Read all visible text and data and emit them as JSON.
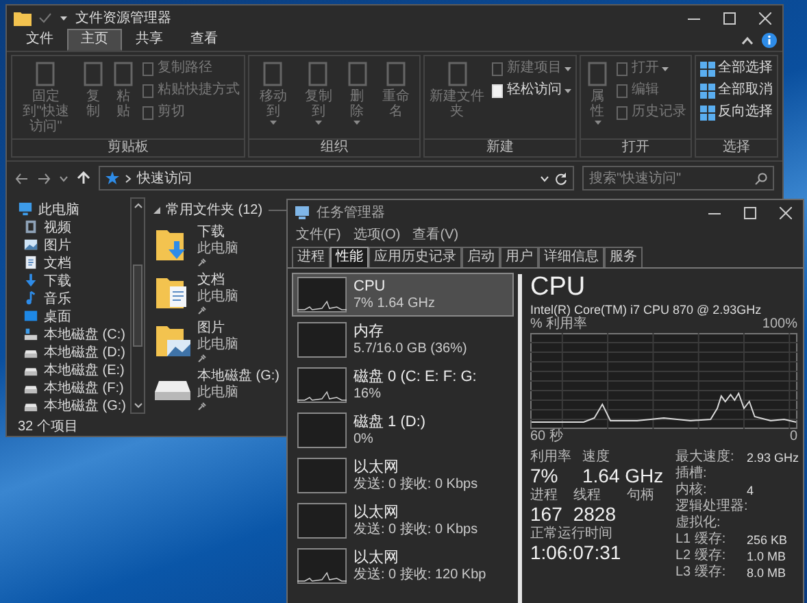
{
  "explorer": {
    "title": "文件资源管理器",
    "tabs": [
      {
        "label": "文件",
        "selected": false
      },
      {
        "label": "主页",
        "selected": true
      },
      {
        "label": "共享",
        "selected": false
      },
      {
        "label": "查看",
        "selected": false
      }
    ],
    "ribbon_groups": [
      {
        "label": "剪贴板",
        "buttons": [
          {
            "label": "固定到\"快速访问\"",
            "kind": "large",
            "disabled": true,
            "dropdown": false
          },
          {
            "label": "复制",
            "kind": "large",
            "disabled": true,
            "dropdown": false
          },
          {
            "label": "粘贴",
            "kind": "large",
            "disabled": true,
            "dropdown": false
          },
          {
            "label": "复制路径",
            "kind": "small",
            "disabled": true,
            "dropdown": false
          },
          {
            "label": "粘贴快捷方式",
            "kind": "small",
            "disabled": true,
            "dropdown": false
          },
          {
            "label": "剪切",
            "kind": "small",
            "disabled": true,
            "dropdown": false
          }
        ]
      },
      {
        "label": "组织",
        "buttons": [
          {
            "label": "移动到",
            "kind": "large",
            "disabled": true,
            "dropdown": true
          },
          {
            "label": "复制到",
            "kind": "large",
            "disabled": true,
            "dropdown": true
          },
          {
            "label": "删除",
            "kind": "large",
            "disabled": true,
            "dropdown": true
          },
          {
            "label": "重命名",
            "kind": "large",
            "disabled": true,
            "dropdown": false
          }
        ]
      },
      {
        "label": "新建",
        "buttons": [
          {
            "label": "新建文件夹",
            "kind": "large",
            "disabled": true,
            "dropdown": false
          },
          {
            "label": "新建项目",
            "kind": "small",
            "disabled": true,
            "dropdown": true
          },
          {
            "label": "轻松访问",
            "kind": "small",
            "disabled": false,
            "dropdown": true
          }
        ]
      },
      {
        "label": "打开",
        "buttons": [
          {
            "label": "属性",
            "kind": "large",
            "disabled": true,
            "dropdown": true
          },
          {
            "label": "打开",
            "kind": "small",
            "disabled": true,
            "dropdown": true
          },
          {
            "label": "编辑",
            "kind": "small",
            "disabled": true,
            "dropdown": false
          },
          {
            "label": "历史记录",
            "kind": "small",
            "disabled": true,
            "dropdown": false
          }
        ]
      },
      {
        "label": "选择",
        "buttons": [
          {
            "label": "全部选择",
            "kind": "grid",
            "disabled": false,
            "dropdown": false
          },
          {
            "label": "全部取消",
            "kind": "grid",
            "disabled": false,
            "dropdown": false
          },
          {
            "label": "反向选择",
            "kind": "grid",
            "disabled": false,
            "dropdown": false
          }
        ]
      }
    ],
    "address": "快速访问",
    "search": {
      "placeholder": "搜索\"快速访问\""
    },
    "nav": [
      {
        "label": "此电脑",
        "kind": "pc",
        "children": [
          {
            "label": "视频",
            "kind": "video"
          },
          {
            "label": "图片",
            "kind": "pictures"
          },
          {
            "label": "文档",
            "kind": "documents"
          },
          {
            "label": "下载",
            "kind": "downloads"
          },
          {
            "label": "音乐",
            "kind": "music"
          },
          {
            "label": "桌面",
            "kind": "desktop"
          },
          {
            "label": "本地磁盘 (C:)",
            "kind": "system-drive"
          },
          {
            "label": "本地磁盘 (D:)",
            "kind": "drive"
          },
          {
            "label": "本地磁盘 (E:)",
            "kind": "drive"
          },
          {
            "label": "本地磁盘 (F:)",
            "kind": "drive"
          },
          {
            "label": "本地磁盘 (G:)",
            "kind": "drive"
          }
        ]
      }
    ],
    "section": "常用文件夹 (12)",
    "items": [
      {
        "name": "下载",
        "location": "此电脑",
        "kind": "downloads"
      },
      {
        "name": "文档",
        "location": "此电脑",
        "kind": "documents"
      },
      {
        "name": "图片",
        "location": "此电脑",
        "kind": "pictures"
      },
      {
        "name": "本地磁盘 (G:)",
        "location": "此电脑",
        "kind": "drive"
      }
    ],
    "status": "32 个项目"
  },
  "task_manager": {
    "title": "任务管理器",
    "menu": [
      "文件(F)",
      "选项(O)",
      "查看(V)"
    ],
    "tabs": [
      {
        "label": "进程",
        "selected": false
      },
      {
        "label": "性能",
        "selected": true
      },
      {
        "label": "应用历史记录",
        "selected": false
      },
      {
        "label": "启动",
        "selected": false
      },
      {
        "label": "用户",
        "selected": false
      },
      {
        "label": "详细信息",
        "selected": false
      },
      {
        "label": "服务",
        "selected": false
      }
    ],
    "resources": [
      {
        "name": "CPU",
        "detail": "7% 1.64 GHz",
        "selected": true,
        "activity": true
      },
      {
        "name": "内存",
        "detail": "5.7/16.0 GB (36%)",
        "selected": false,
        "activity": false
      },
      {
        "name": "磁盘 0 (C: E: F: G:",
        "detail": "16%",
        "selected": false,
        "activity": true
      },
      {
        "name": "磁盘 1 (D:)",
        "detail": "0%",
        "selected": false,
        "activity": false
      },
      {
        "name": "以太网",
        "detail": "发送: 0 接收: 0 Kbps",
        "selected": false,
        "activity": false
      },
      {
        "name": "以太网",
        "detail": "发送: 0 接收: 0 Kbps",
        "selected": false,
        "activity": false
      },
      {
        "name": "以太网",
        "detail": "发送: 0 接收: 120 Kbp",
        "selected": false,
        "activity": true
      }
    ],
    "detail": {
      "title": "CPU",
      "model": "Intel(R) Core(TM) i7 CPU 870 @ 2.93GHz",
      "graph_label": "% 利用率",
      "graph_max": "100%",
      "graph_span": "60 秒",
      "graph_min": "0",
      "stats": [
        [
          {
            "label": "利用率",
            "value": "7%"
          },
          {
            "label": "速度",
            "value": "1.64 GHz"
          }
        ],
        [
          {
            "label": "进程",
            "value": "167"
          },
          {
            "label": "线程",
            "value": "2828"
          },
          {
            "label": "句柄"
          }
        ],
        [
          {
            "label": "正常运行时间",
            "value": "1:06:07:31"
          }
        ]
      ],
      "specs": [
        {
          "label": "最大速度:",
          "value": "2.93 GHz"
        },
        {
          "label": "插槽:"
        },
        {
          "label": "内核:",
          "value": "4"
        },
        {
          "label": "逻辑处理器:"
        },
        {
          "label": "虚拟化:"
        },
        {
          "label": "L1 缓存:",
          "value": "256 KB"
        },
        {
          "label": "L2 缓存:",
          "value": "1.0 MB"
        },
        {
          "label": "L3 缓存:",
          "value": "8.0 MB"
        }
      ]
    }
  }
}
